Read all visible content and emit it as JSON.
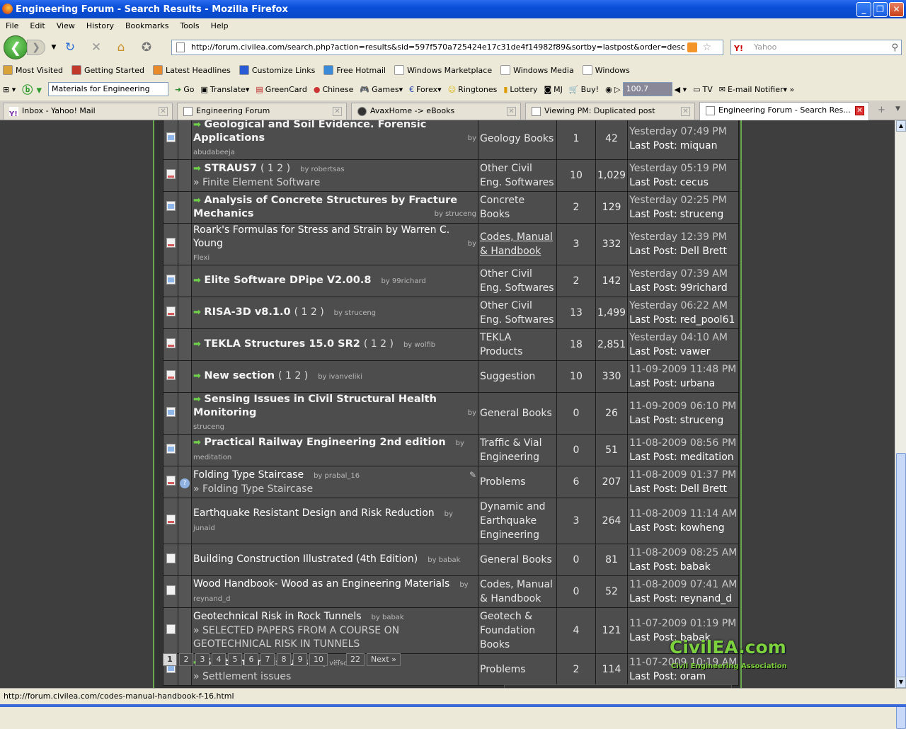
{
  "window": {
    "title": "Engineering Forum - Search Results - Mozilla Firefox"
  },
  "menu": [
    "File",
    "Edit",
    "View",
    "History",
    "Bookmarks",
    "Tools",
    "Help"
  ],
  "address": {
    "url": "http://forum.civilea.com/search.php?action=results&sid=597f570a725424e17c31de4f14982f89&sortby=lastpost&order=desc"
  },
  "search": {
    "placeholder": "Yahoo",
    "engine": "Y!"
  },
  "bookmarks": [
    {
      "label": "Most Visited",
      "color": "#d9a33a"
    },
    {
      "label": "Getting Started",
      "color": "#c0392b"
    },
    {
      "label": "Latest Headlines",
      "color": "#e88a2a"
    },
    {
      "label": "Customize Links",
      "color": "#2a5bd7"
    },
    {
      "label": "Free Hotmail",
      "color": "#3a8ad7"
    },
    {
      "label": "Windows Marketplace",
      "color": "#ffffff"
    },
    {
      "label": "Windows Media",
      "color": "#ffffff"
    },
    {
      "label": "Windows",
      "color": "#ffffff"
    }
  ],
  "toolbar2": {
    "search_select": "Materials for Engineering",
    "go": "Go",
    "translate": "Translate",
    "greencard": "GreenCard",
    "chinese": "Chinese",
    "games": "Games",
    "forex": "Forex",
    "ringtones": "Ringtones",
    "lottery": "Lottery",
    "mj": "MJ",
    "buy": "Buy!",
    "volume": "100.7",
    "tv": "TV",
    "email": "E-mail Notifier"
  },
  "tabs": [
    {
      "label": "Inbox - Yahoo! Mail",
      "active": false
    },
    {
      "label": "Engineering Forum",
      "active": false
    },
    {
      "label": "AvaxHome -> eBooks",
      "active": false
    },
    {
      "label": "Viewing PM: Duplicated post",
      "active": false
    },
    {
      "label": "Engineering Forum - Search Res...",
      "active": true
    }
  ],
  "rows": [
    {
      "icon": "new",
      "arrow": true,
      "title": "Geological and Soil Evidence. Forensic Applications",
      "bold": true,
      "by": "by",
      "author": "abudabeeja",
      "author_wrap": true,
      "pages": "",
      "sub": "",
      "forum": "Geology Books",
      "underline": false,
      "replies": "1",
      "views": "42",
      "last_date": "Yesterday 07:49 PM",
      "last_user": "miquan"
    },
    {
      "icon": "hot",
      "arrow": true,
      "title": "STRAUS7",
      "bold": true,
      "by": "by robertsas",
      "author": "",
      "author_wrap": false,
      "pages": "( 1 2 )",
      "sub": "» Finite Element Software",
      "forum": "Other Civil Eng. Softwares",
      "underline": false,
      "replies": "10",
      "views": "1,029",
      "last_date": "Yesterday 05:19 PM",
      "last_user": "cecus"
    },
    {
      "icon": "new",
      "arrow": true,
      "title": "Analysis of Concrete Structures by Fracture Mechanics",
      "bold": true,
      "by": "by struceng",
      "author": "",
      "author_wrap": true,
      "pages": "",
      "sub": "",
      "forum": "Concrete Books",
      "underline": false,
      "replies": "2",
      "views": "129",
      "last_date": "Yesterday 02:25 PM",
      "last_user": "struceng"
    },
    {
      "icon": "hot",
      "arrow": false,
      "title": "Roark's Formulas for Stress and Strain by Warren C. Young",
      "bold": false,
      "by": "by",
      "author": "Flexi",
      "author_wrap": true,
      "pages": "",
      "sub": "",
      "forum": "Codes, Manual & Handbook",
      "underline": true,
      "replies": "3",
      "views": "332",
      "last_date": "Yesterday 12:39 PM",
      "last_user": "Dell Brett"
    },
    {
      "icon": "new",
      "arrow": true,
      "title": "Elite Software DPipe V2.00.8",
      "bold": true,
      "by": "by 99richard",
      "author": "",
      "author_wrap": false,
      "pages": "",
      "sub": "",
      "forum": "Other Civil Eng. Softwares",
      "underline": false,
      "replies": "2",
      "views": "142",
      "last_date": "Yesterday 07:39 AM",
      "last_user": "99richard"
    },
    {
      "icon": "hot",
      "arrow": true,
      "title": "RISA-3D v8.1.0",
      "bold": true,
      "by": "by struceng",
      "author": "",
      "author_wrap": false,
      "pages": "( 1 2 )",
      "sub": "",
      "forum": "Other Civil Eng. Softwares",
      "underline": false,
      "replies": "13",
      "views": "1,499",
      "last_date": "Yesterday 06:22 AM",
      "last_user": "red_pool61"
    },
    {
      "icon": "hot",
      "arrow": true,
      "title": "TEKLA Structures 15.0 SR2",
      "bold": true,
      "by": "by wolfib",
      "author": "",
      "author_wrap": false,
      "pages": "( 1 2 )",
      "sub": "",
      "forum": "TEKLA Products",
      "underline": false,
      "replies": "18",
      "views": "2,851",
      "last_date": "Yesterday 04:10 AM",
      "last_user": "vawer"
    },
    {
      "icon": "hot",
      "arrow": true,
      "title": "New section",
      "bold": true,
      "by": "by ivanveliki",
      "author": "",
      "author_wrap": false,
      "pages": "( 1 2 )",
      "sub": "",
      "forum": "Suggestion",
      "underline": false,
      "replies": "10",
      "views": "330",
      "last_date": "11-09-2009 11:48 PM",
      "last_user": "urbana"
    },
    {
      "icon": "new",
      "arrow": true,
      "title": "Sensing Issues in Civil Structural Health Monitoring",
      "bold": true,
      "by": "by",
      "author": "struceng",
      "author_wrap": true,
      "pages": "",
      "sub": "",
      "forum": "General Books",
      "underline": false,
      "replies": "0",
      "views": "26",
      "last_date": "11-09-2009 06:10 PM",
      "last_user": "struceng"
    },
    {
      "icon": "new",
      "arrow": true,
      "title": "Practical Railway Engineering 2nd edition",
      "bold": true,
      "by": "by meditation",
      "author": "",
      "author_wrap": false,
      "pages": "",
      "sub": "",
      "forum": "Traffic & Vial Engineering",
      "underline": false,
      "replies": "0",
      "views": "51",
      "last_date": "11-08-2009 08:56 PM",
      "last_user": "meditation"
    },
    {
      "icon": "hot",
      "arrow": false,
      "title": "Folding Type Staircase",
      "bold": false,
      "by": "by prabal_16",
      "author": "",
      "author_wrap": false,
      "pages": "",
      "sub": "» Folding Type Staircase",
      "forum": "Problems",
      "underline": false,
      "replies": "6",
      "views": "207",
      "last_date": "11-08-2009 01:37 PM",
      "last_user": "Dell Brett",
      "qmark": true,
      "clip": true
    },
    {
      "icon": "hot",
      "arrow": false,
      "title": "Earthquake Resistant Design and Risk Reduction",
      "bold": false,
      "by": "by junaid",
      "author": "",
      "author_wrap": false,
      "pages": "",
      "sub": "",
      "forum": "Dynamic and Earthquake Engineering",
      "underline": false,
      "replies": "3",
      "views": "264",
      "last_date": "11-08-2009 11:14 AM",
      "last_user": "kowheng"
    },
    {
      "icon": "plain",
      "arrow": false,
      "title": "Building Construction Illustrated (4th Edition)",
      "bold": false,
      "by": "by babak",
      "author": "",
      "author_wrap": false,
      "pages": "",
      "sub": "",
      "forum": "General Books",
      "underline": false,
      "replies": "0",
      "views": "81",
      "last_date": "11-08-2009 08:25 AM",
      "last_user": "babak"
    },
    {
      "icon": "plain",
      "arrow": false,
      "title": "Wood Handbook- Wood as an Engineering Materials",
      "bold": false,
      "by": "by reynand_d",
      "author": "",
      "author_wrap": false,
      "pages": "",
      "sub": "",
      "forum": "Codes, Manual & Handbook",
      "underline": false,
      "replies": "0",
      "views": "52",
      "last_date": "11-08-2009 07:41 AM",
      "last_user": "reynand_d"
    },
    {
      "icon": "plain",
      "arrow": false,
      "title": "Geotechnical Risk in Rock Tunnels",
      "bold": false,
      "by": "by babak",
      "author": "",
      "author_wrap": false,
      "pages": "",
      "sub": "» SELECTED PAPERS FROM A COURSE ON GEOTECHNICAL RISK IN TUNNELS",
      "forum": "Geotech & Foundation Books",
      "underline": false,
      "replies": "4",
      "views": "121",
      "last_date": "11-07-2009 01:19 PM",
      "last_user": "babak"
    },
    {
      "icon": "new",
      "arrow": true,
      "title": "Settlement issues",
      "bold": true,
      "by": "by velscit",
      "author": "",
      "author_wrap": false,
      "pages": "",
      "sub": "» Settlement issues",
      "forum": "Problems",
      "underline": false,
      "replies": "2",
      "views": "114",
      "last_date": "11-07-2009 10:19 AM",
      "last_user": "oram"
    }
  ],
  "last_post_prefix": "Last Post:",
  "pagination": [
    "1",
    "2",
    "3",
    "4",
    "5",
    "6",
    "7",
    "8",
    "9",
    "10",
    "...",
    "22",
    "Next »"
  ],
  "watermark": {
    "main": "CivilEA.com",
    "sub": "Civil Engineering Association"
  },
  "status": {
    "text": "http://forum.civilea.com/codes-manual-handbook-f-16.html"
  }
}
